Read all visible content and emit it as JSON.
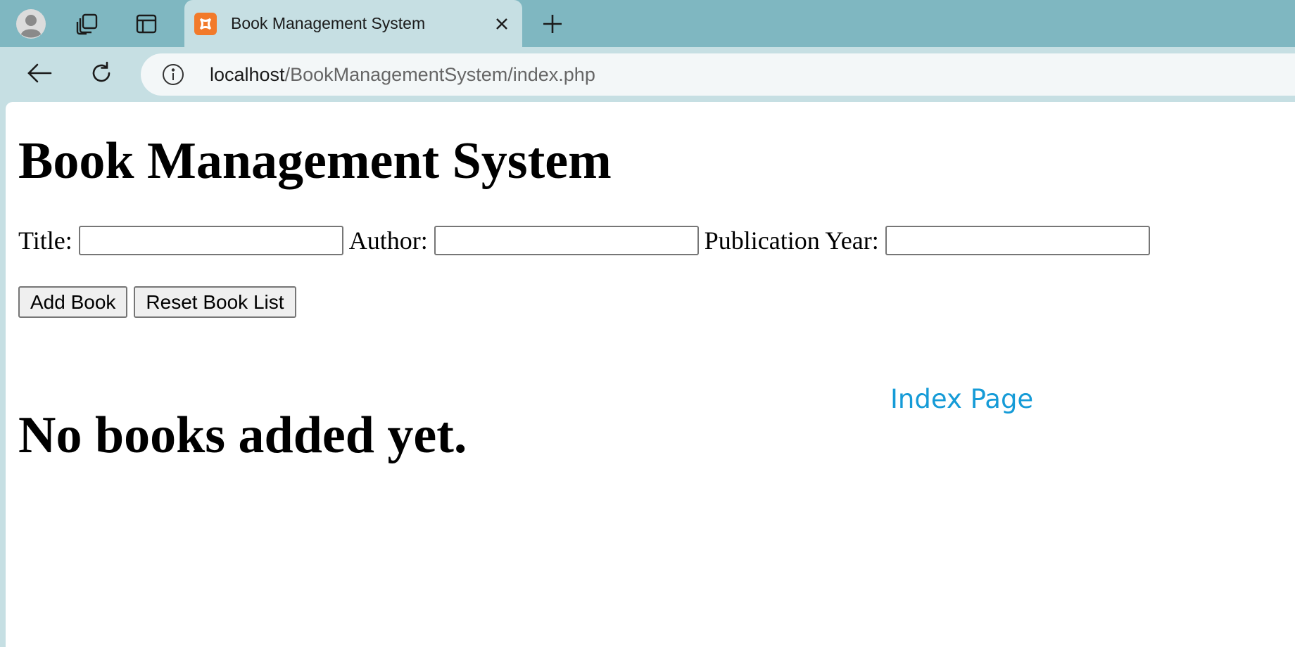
{
  "browser": {
    "tab": {
      "title": "Book Management System",
      "favicon": "xampp-icon"
    },
    "address_bar": {
      "host": "localhost",
      "path": "/BookManagementSystem/index.php"
    },
    "icons": {
      "profile": "profile-avatar-icon",
      "workspaces": "workspaces-icon",
      "tab_actions": "tab-actions-icon",
      "close": "close-icon",
      "new_tab": "plus-icon",
      "back": "back-arrow-icon",
      "refresh": "refresh-icon",
      "site_info": "info-icon"
    },
    "colors": {
      "tab_strip": "#7fb7c1",
      "toolbar": "#c6dfe3",
      "favicon": "#f27a2a"
    }
  },
  "page": {
    "heading": "Book Management System",
    "form": {
      "title_label": "Title:",
      "title_value": "",
      "author_label": "Author:",
      "author_value": "",
      "year_label": "Publication Year:",
      "year_value": ""
    },
    "buttons": {
      "add": "Add Book",
      "reset": "Reset Book List"
    },
    "index_link": "Index Page",
    "empty_message": "No books added yet.",
    "colors": {
      "link": "#159bd7"
    }
  }
}
